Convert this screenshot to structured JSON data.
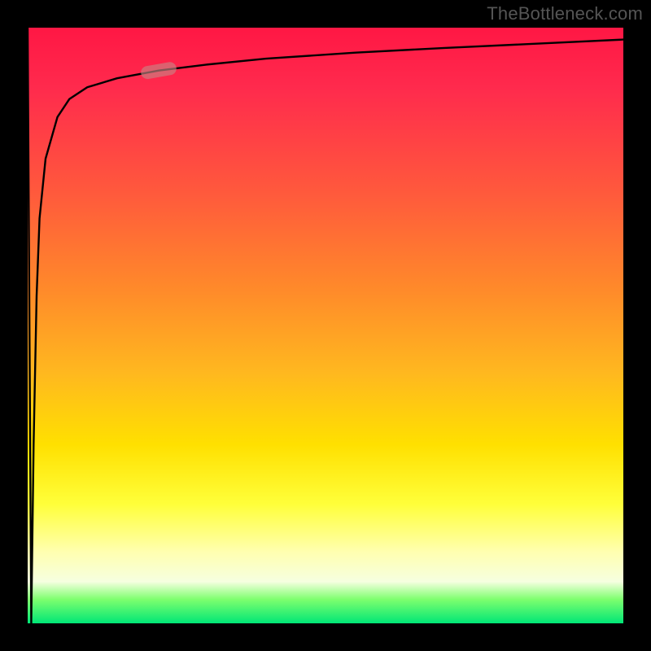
{
  "attribution": "TheBottleneck.com",
  "colors": {
    "frame": "#000000",
    "gradient_top": "#ff1744",
    "gradient_mid1": "#ff8a2a",
    "gradient_mid2": "#ffe000",
    "gradient_mid3": "#ffff3a",
    "gradient_bottom": "#00e676",
    "curve": "#000000",
    "marker": "rgba(200,130,130,0.65)"
  },
  "chart_data": {
    "type": "line",
    "title": "",
    "xlabel": "",
    "ylabel": "",
    "xlim": [
      0,
      100
    ],
    "ylim": [
      0,
      100
    ],
    "x": [
      0,
      0.6,
      1,
      1.5,
      2,
      3,
      5,
      7,
      10,
      15,
      22,
      30,
      40,
      55,
      70,
      85,
      100
    ],
    "values": [
      100,
      0,
      30,
      55,
      68,
      78,
      85,
      88,
      90,
      91.5,
      92.8,
      93.8,
      94.8,
      95.8,
      96.6,
      97.3,
      98
    ],
    "annotations": [
      {
        "type": "marker",
        "x": 22,
        "y": 92.8,
        "label": "highlight"
      }
    ],
    "note": "x,y on 0–100 canonical axes; curve drops from top-left to bottom then rises steeply and asymptotes near top"
  }
}
